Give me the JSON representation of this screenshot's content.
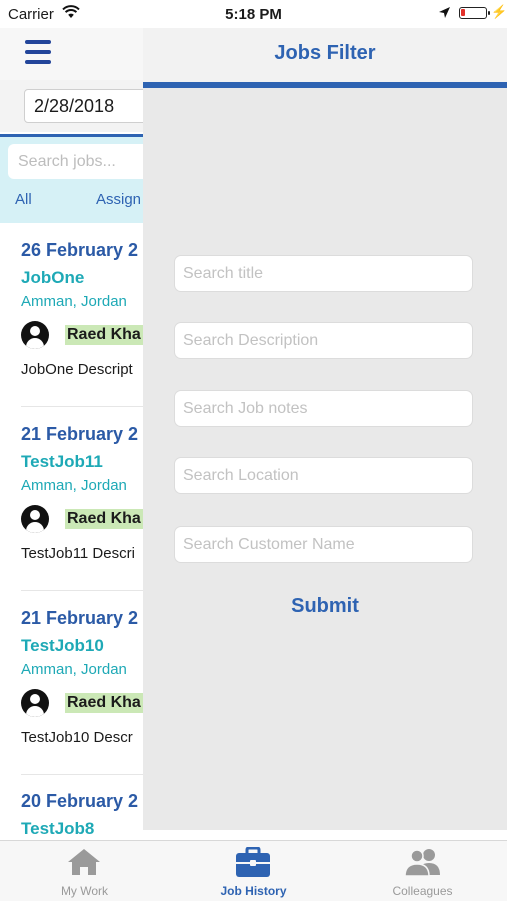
{
  "status": {
    "carrier": "Carrier",
    "time": "5:18 PM"
  },
  "main": {
    "date": "2/28/2018",
    "search_placeholder": "Search jobs...",
    "segments": [
      "All",
      "Assign"
    ],
    "jobs": [
      {
        "date": "26 February 2",
        "title": "JobOne",
        "location": "Amman, Jordan",
        "user": "Raed Kha",
        "description": "JobOne Descript"
      },
      {
        "date": "21 February 2",
        "title": "TestJob11",
        "location": "Amman, Jordan",
        "user": "Raed Kha",
        "description": "TestJob11 Descri"
      },
      {
        "date": "21 February 2",
        "title": "TestJob10",
        "location": "Amman, Jordan",
        "user": "Raed Kha",
        "description": "TestJob10 Descr"
      },
      {
        "date": "20 February 2",
        "title": "TestJob8"
      }
    ]
  },
  "filter": {
    "title": "Jobs Filter",
    "fields": {
      "title": "Search title",
      "description": "Search Description",
      "notes": "Search Job notes",
      "location": "Search Location",
      "customer": "Search Customer Name"
    },
    "submit": "Submit"
  },
  "tabs": [
    {
      "label": "My Work",
      "icon": "home-icon"
    },
    {
      "label": "Job History",
      "icon": "briefcase-icon",
      "active": true
    },
    {
      "label": "Colleagues",
      "icon": "people-icon"
    }
  ],
  "colors": {
    "accent": "#2e63b2",
    "teal": "#1ea9b6",
    "overlay": "#e9e9e9"
  }
}
